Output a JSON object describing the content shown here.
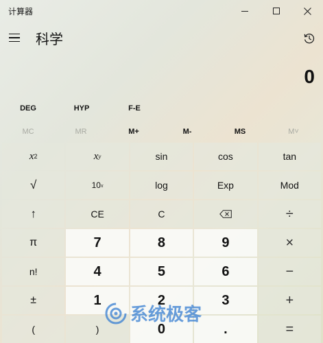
{
  "window": {
    "title": "计算器",
    "minimize_icon": "minimize-icon",
    "maximize_icon": "maximize-icon",
    "close_icon": "close-icon"
  },
  "header": {
    "menu_icon": "hamburger-menu-icon",
    "mode_title": "科学",
    "history_icon": "history-icon"
  },
  "display": {
    "value": "0"
  },
  "modes": {
    "deg": "DEG",
    "hyp": "HYP",
    "fe": "F-E"
  },
  "memory": {
    "mc": "MC",
    "mr": "MR",
    "mplus": "M+",
    "mminus": "M-",
    "ms": "MS",
    "mlist": "M˅"
  },
  "keys": {
    "x2_base": "x",
    "x2_exp": "2",
    "xy_base": "x",
    "xy_exp": "y",
    "sin": "sin",
    "cos": "cos",
    "tan": "tan",
    "sqrt": "√",
    "ten_base": "10",
    "ten_exp": "x",
    "log": "log",
    "exp": "Exp",
    "mod": "Mod",
    "shift": "↑",
    "ce": "CE",
    "c": "C",
    "backspace_icon": "backspace-icon",
    "divide": "÷",
    "pi": "π",
    "d7": "7",
    "d8": "8",
    "d9": "9",
    "multiply": "×",
    "fact": "n!",
    "d4": "4",
    "d5": "5",
    "d6": "6",
    "minus": "−",
    "negate": "±",
    "d1": "1",
    "d2": "2",
    "d3": "3",
    "plus": "+",
    "lparen": "(",
    "rparen": ")",
    "d0": "0",
    "decimal": ".",
    "equals": "="
  },
  "watermark": {
    "text": "系统极客",
    "logo": "watermark-logo-icon"
  }
}
